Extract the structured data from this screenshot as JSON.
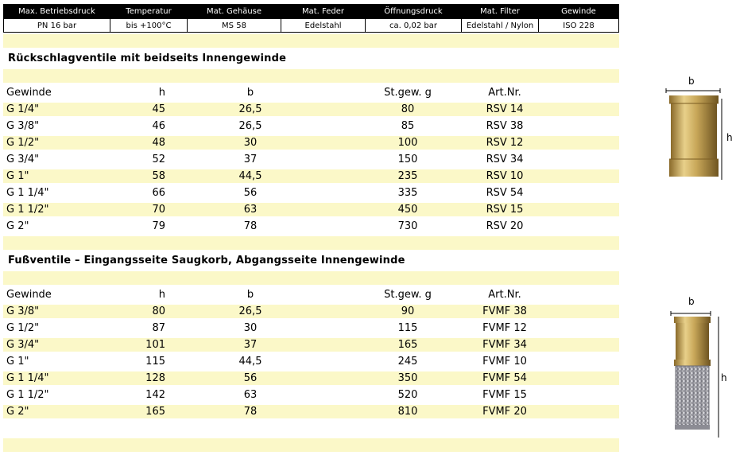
{
  "specs": {
    "headers": [
      "Max. Betriebsdruck",
      "Temperatur",
      "Mat. Gehäuse",
      "Mat. Feder",
      "Öffnungsdruck",
      "Mat. Filter",
      "Gewinde"
    ],
    "values": [
      "PN 16 bar",
      "bis +100°C",
      "MS 58",
      "Edelstahl",
      "ca. 0,02 bar",
      "Edelstahl / Nylon",
      "ISO 228"
    ]
  },
  "section1": {
    "title": "Rückschlagventile mit beidseits Innengewinde",
    "columns": [
      "Gewinde",
      "h",
      "b",
      "St.gew. g",
      "Art.Nr."
    ],
    "rows": [
      [
        "G 1/4\"",
        "45",
        "26,5",
        "80",
        "RSV 14"
      ],
      [
        "G 3/8\"",
        "46",
        "26,5",
        "85",
        "RSV 38"
      ],
      [
        "G 1/2\"",
        "48",
        "30",
        "100",
        "RSV 12"
      ],
      [
        "G 3/4\"",
        "52",
        "37",
        "150",
        "RSV 34"
      ],
      [
        "G 1\"",
        "58",
        "44,5",
        "235",
        "RSV 10"
      ],
      [
        "G 1 1/4\"",
        "66",
        "56",
        "335",
        "RSV 54"
      ],
      [
        "G 1 1/2\"",
        "70",
        "63",
        "450",
        "RSV 15"
      ],
      [
        "G 2\"",
        "79",
        "78",
        "730",
        "RSV 20"
      ]
    ],
    "dim_b": "b",
    "dim_h": "h"
  },
  "section2": {
    "title": "Fußventile – Eingangsseite Saugkorb, Abgangsseite Innengewinde",
    "columns": [
      "Gewinde",
      "h",
      "b",
      "St.gew. g",
      "Art.Nr."
    ],
    "rows": [
      [
        "G 3/8\"",
        "80",
        "26,5",
        "90",
        "FVMF 38"
      ],
      [
        "G 1/2\"",
        "87",
        "30",
        "115",
        "FVMF 12"
      ],
      [
        "G 3/4\"",
        "101",
        "37",
        "165",
        "FVMF 34"
      ],
      [
        "G 1\"",
        "115",
        "44,5",
        "245",
        "FVMF 10"
      ],
      [
        "G 1 1/4\"",
        "128",
        "56",
        "350",
        "FVMF 54"
      ],
      [
        "G 1 1/2\"",
        "142",
        "63",
        "520",
        "FVMF 15"
      ],
      [
        "G 2\"",
        "165",
        "78",
        "810",
        "FVMF 20"
      ]
    ],
    "dim_b": "b",
    "dim_h": "h"
  },
  "colors": {
    "band": "#fbf8c8",
    "header_bg": "#000000",
    "brass": "#c9a85a"
  }
}
